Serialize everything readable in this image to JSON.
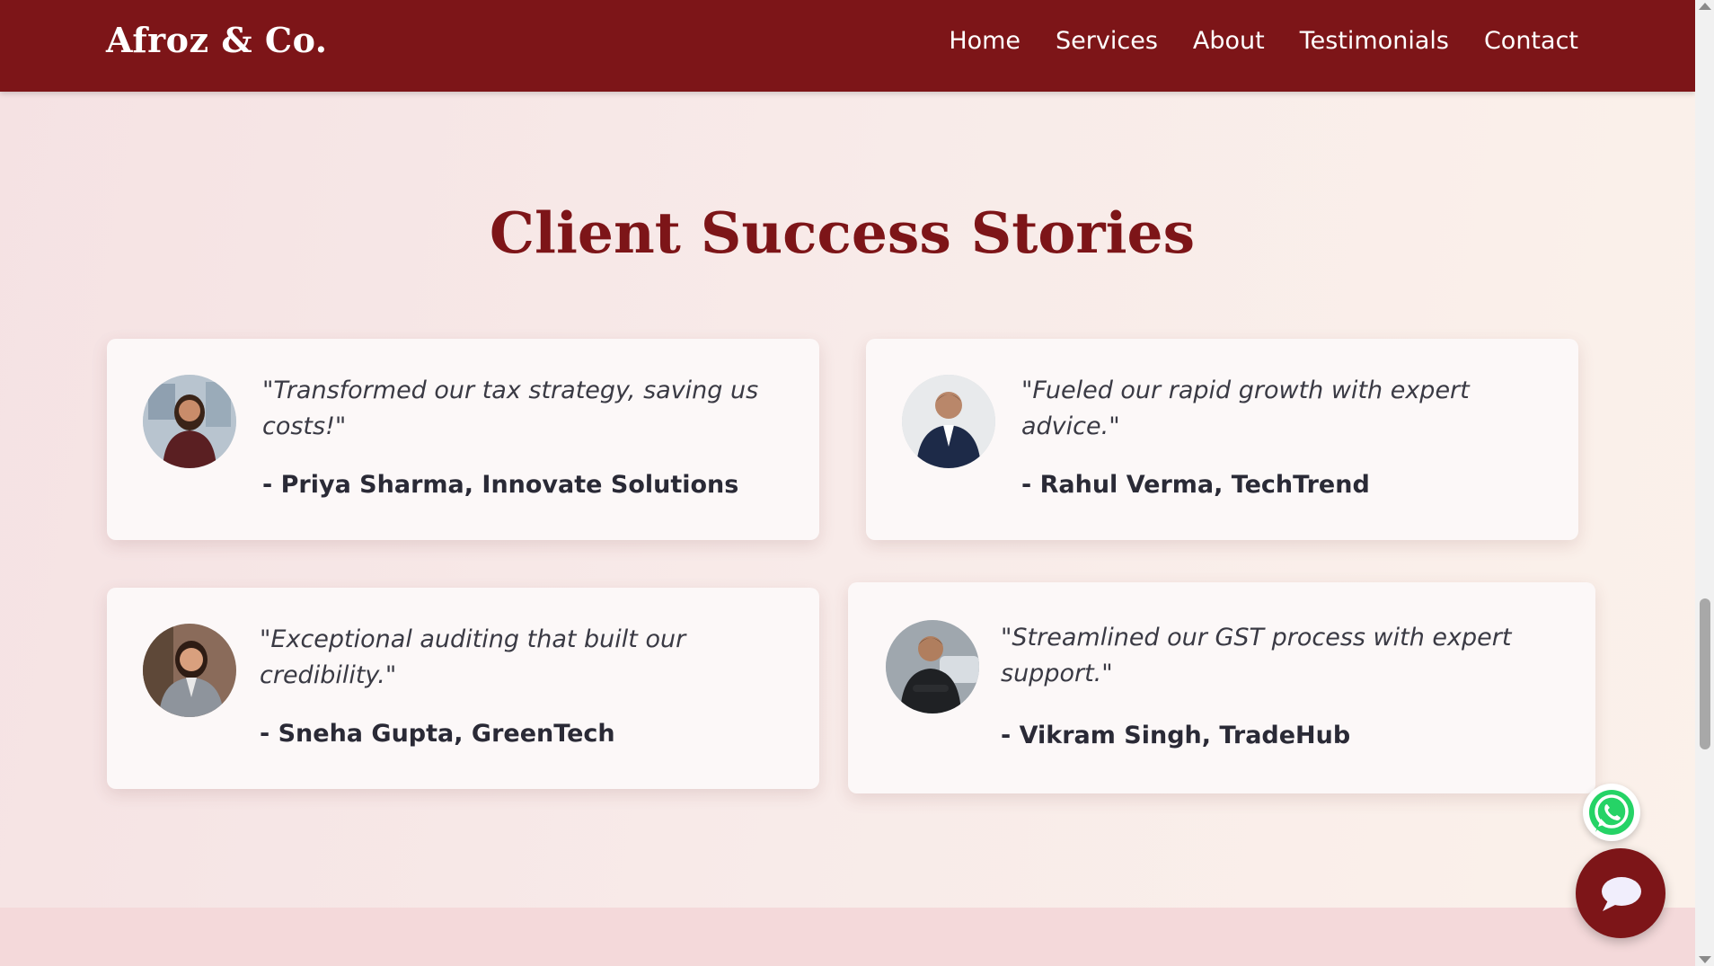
{
  "brand": {
    "name": "Afroz & Co."
  },
  "nav": {
    "items": [
      {
        "label": "Home"
      },
      {
        "label": "Services"
      },
      {
        "label": "About"
      },
      {
        "label": "Testimonials"
      },
      {
        "label": "Contact"
      }
    ]
  },
  "section": {
    "title": "Client Success Stories"
  },
  "testimonials": [
    {
      "quote": "\"Transformed our tax strategy, saving us costs!\"",
      "author": "- Priya Sharma, Innovate Solutions"
    },
    {
      "quote": "\"Fueled our rapid growth with expert advice.\"",
      "author": "- Rahul Verma, TechTrend"
    },
    {
      "quote": "\"Exceptional auditing that built our credibility.\"",
      "author": "- Sneha Gupta, GreenTech"
    },
    {
      "quote": "\"Streamlined our GST process with expert support.\"",
      "author": "- Vikram Singh, TradeHub"
    }
  ],
  "floating": {
    "whatsapp_icon": "whatsapp-icon",
    "chat_icon": "chat-bubble-icon"
  },
  "colors": {
    "brand_primary": "#7d1518",
    "whatsapp_green": "#25d366",
    "text_dark": "#2a2a36"
  }
}
